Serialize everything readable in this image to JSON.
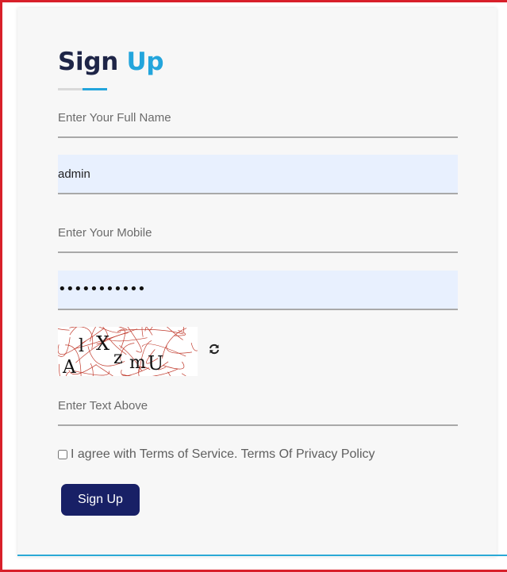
{
  "form": {
    "title_part1": "Sign",
    "title_part2": "Up",
    "fullname": {
      "placeholder": "Enter Your Full Name",
      "value": ""
    },
    "username": {
      "value": "admin"
    },
    "mobile": {
      "placeholder": "Enter Your Mobile",
      "value": ""
    },
    "password": {
      "masked": "•••••••••••"
    },
    "captcha": {
      "text": "AlXzmU",
      "icon": "refresh-icon"
    },
    "captcha_input": {
      "placeholder": "Enter Text Above",
      "value": ""
    },
    "agree": {
      "label": "I agree with Terms of Service. Terms Of Privacy Policy",
      "checked": false
    },
    "submit_label": "Sign Up"
  },
  "colors": {
    "frame": "#d8202a",
    "title_dark": "#1e2547",
    "accent": "#23a5dc",
    "button_bg": "#182066",
    "autofill_bg": "#e8f0fe",
    "captcha_lines": "#c0392b"
  }
}
